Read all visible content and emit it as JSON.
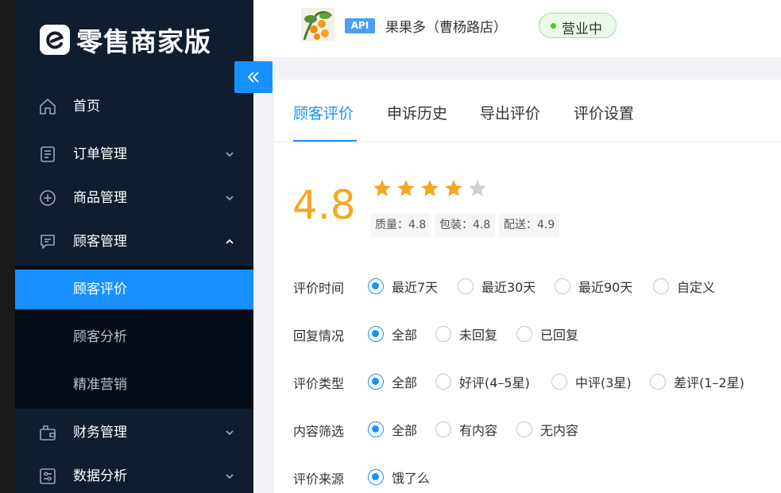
{
  "app": {
    "name": "零售商家版"
  },
  "sidebar": {
    "items": [
      {
        "label": "首页",
        "icon": "home-icon"
      },
      {
        "label": "订单管理",
        "icon": "order-icon"
      },
      {
        "label": "商品管理",
        "icon": "plus-circle-icon"
      },
      {
        "label": "顾客管理",
        "icon": "comment-icon",
        "expanded": true
      },
      {
        "label": "财务管理",
        "icon": "wallet-icon"
      },
      {
        "label": "数据分析",
        "icon": "sliders-icon"
      }
    ],
    "subitems": [
      {
        "label": "顾客评价",
        "active": true
      },
      {
        "label": "顾客分析"
      },
      {
        "label": "精准营销"
      }
    ]
  },
  "header": {
    "api_badge": "API",
    "store_name": "果果多（曹杨路店）",
    "status": "营业中"
  },
  "tabs": [
    "顾客评价",
    "申诉历史",
    "导出评价",
    "评价设置"
  ],
  "active_tab": "顾客评价",
  "rating": {
    "score": "4.8",
    "stars_filled": 4,
    "stars_total": 5,
    "quality": "质量：4.8",
    "packaging": "包装：4.8",
    "delivery": "配送：4.9"
  },
  "filters": [
    {
      "label": "评价时间",
      "options": [
        "最近7天",
        "最近30天",
        "最近90天",
        "自定义"
      ],
      "selected": 0
    },
    {
      "label": "回复情况",
      "options": [
        "全部",
        "未回复",
        "已回复"
      ],
      "selected": 0
    },
    {
      "label": "评价类型",
      "options": [
        "全部",
        "好评(4–5星)",
        "中评(3星)",
        "差评(1–2星)"
      ],
      "selected": 0
    },
    {
      "label": "内容筛选",
      "options": [
        "全部",
        "有内容",
        "无内容"
      ],
      "selected": 0
    },
    {
      "label": "评价来源",
      "options": [
        "饿了么"
      ],
      "selected": 0
    }
  ],
  "colors": {
    "accent": "#1890ff",
    "sidebar": "#0f1d2e",
    "star": "#f5a623",
    "status_green": "#52c41a"
  }
}
